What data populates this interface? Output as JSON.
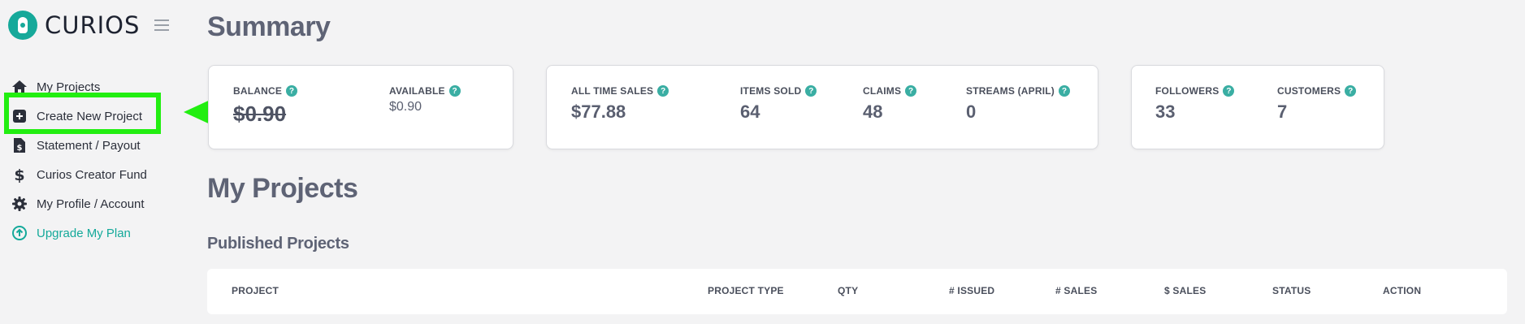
{
  "brand": {
    "name": "CURIOS",
    "color": "#16a99a"
  },
  "sidebar": {
    "items": [
      {
        "label": "My Projects",
        "icon": "home-icon"
      },
      {
        "label": "Create New Project",
        "icon": "plus-square-icon"
      },
      {
        "label": "Statement / Payout",
        "icon": "dollar-document-icon"
      },
      {
        "label": "Curios Creator Fund",
        "icon": "dollar-icon"
      },
      {
        "label": "My Profile / Account",
        "icon": "gear-icon"
      },
      {
        "label": "Upgrade My Plan",
        "icon": "arrow-up-circle-icon"
      }
    ]
  },
  "annotation": {
    "highlight_color": "#22ee11"
  },
  "summary": {
    "title": "Summary",
    "balance_card": {
      "balance": {
        "label": "BALANCE",
        "value": "$0.90"
      },
      "available": {
        "label": "AVAILABLE",
        "value": "$0.90"
      }
    },
    "sales_card": {
      "all_time_sales": {
        "label": "ALL TIME SALES",
        "value": "$77.88"
      },
      "items_sold": {
        "label": "ITEMS SOLD",
        "value": "64"
      },
      "claims": {
        "label": "CLAIMS",
        "value": "48"
      },
      "streams": {
        "label": "STREAMS (APRIL)",
        "value": "0"
      }
    },
    "audience_card": {
      "followers": {
        "label": "FOLLOWERS",
        "value": "33"
      },
      "customers": {
        "label": "CUSTOMERS",
        "value": "7"
      }
    }
  },
  "projects": {
    "title": "My Projects",
    "published_title": "Published Projects",
    "columns": [
      "PROJECT",
      "PROJECT TYPE",
      "QTY",
      "# ISSUED",
      "# SALES",
      "$ SALES",
      "STATUS",
      "ACTION"
    ]
  }
}
